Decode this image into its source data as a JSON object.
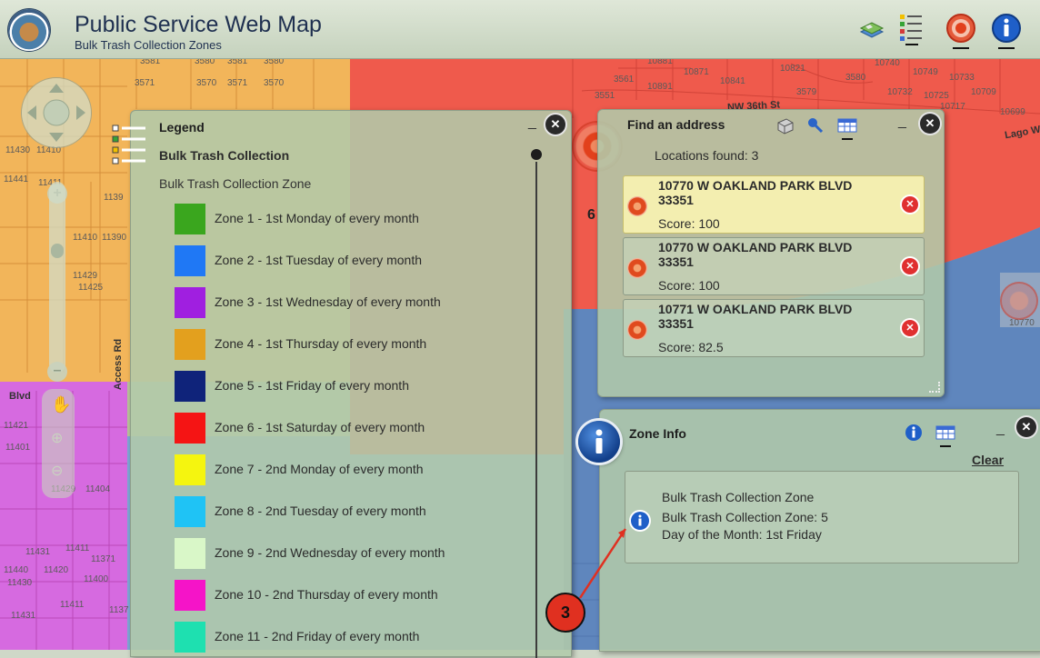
{
  "header": {
    "title": "Public Service Web Map",
    "subtitle": "Bulk Trash Collection Zones",
    "tools": [
      {
        "name": "basemap-icon"
      },
      {
        "name": "layer-list-icon"
      },
      {
        "name": "find-address-icon"
      },
      {
        "name": "info-icon"
      }
    ]
  },
  "map": {
    "street_labels": [
      "NW 36th St",
      "Access Rd",
      "Blvd",
      "Lago W"
    ],
    "parcel_labels": [
      "3581",
      "3580",
      "3581",
      "3580",
      "3571",
      "3570",
      "3571",
      "3570",
      "10881",
      "10871",
      "10841",
      "10821",
      "10740",
      "10749",
      "10733",
      "3561",
      "10891",
      "3579",
      "3580",
      "10732",
      "10725",
      "10709",
      "3551",
      "10717",
      "10699",
      "11430",
      "11410",
      "11441",
      "11411",
      "1139",
      "11410",
      "11390",
      "11429",
      "11425",
      "11421",
      "11401",
      "11431",
      "11411",
      "11371",
      "11429",
      "11404",
      "11440",
      "11420",
      "11400",
      "11430",
      "11411",
      "11431",
      "1137",
      "10770"
    ],
    "zone_labels": [
      "6"
    ]
  },
  "legend": {
    "title": "Legend",
    "layer_name": "Bulk Trash Collection",
    "field_name": "Bulk Trash Collection Zone",
    "minimize": "_",
    "close": "✕",
    "items": [
      {
        "label": "Zone 1 - 1st Monday of every month",
        "color": "#3aa61e"
      },
      {
        "label": "Zone 2 - 1st Tuesday of every month",
        "color": "#1f78f5"
      },
      {
        "label": "Zone 3 - 1st Wednesday of every month",
        "color": "#a01fe0"
      },
      {
        "label": "Zone 4 - 1st Thursday of every month",
        "color": "#e3a01e"
      },
      {
        "label": "Zone 5 - 1st Friday of every month",
        "color": "#0f237a"
      },
      {
        "label": "Zone 6 - 1st Saturday of every month",
        "color": "#f51414"
      },
      {
        "label": "Zone 7 - 2nd Monday of every month",
        "color": "#f5f50f"
      },
      {
        "label": "Zone 8 - 2nd Tuesday of every month",
        "color": "#1fc3f5"
      },
      {
        "label": "Zone 9 - 2nd Wednesday of every month",
        "color": "#d9f7c8"
      },
      {
        "label": "Zone 10 - 2nd Thursday of every month",
        "color": "#f514c8"
      },
      {
        "label": "Zone 11 - 2nd Friday of every month",
        "color": "#1ee0b0"
      }
    ]
  },
  "find_address": {
    "title": "Find an address",
    "minimize": "_",
    "close": "✕",
    "status": "Locations found: 3",
    "results": [
      {
        "address_line1": "10770 W OAKLAND PARK BLVD",
        "address_line2": "33351",
        "score": "Score: 100",
        "selected": true
      },
      {
        "address_line1": "10770 W OAKLAND PARK BLVD",
        "address_line2": "33351",
        "score": "Score: 100",
        "selected": false
      },
      {
        "address_line1": "10771 W OAKLAND PARK BLVD",
        "address_line2": "33351",
        "score": "Score: 82.5",
        "selected": false
      }
    ],
    "remove_glyph": "✕"
  },
  "zone_info": {
    "title": "Zone Info",
    "minimize": "_",
    "close": "✕",
    "clear_label": "Clear",
    "layer": "Bulk Trash Collection Zone",
    "field1": "Bulk Trash Collection Zone: 5",
    "field2": "Day of the Month: 1st Friday"
  },
  "callout": {
    "number": "3",
    "color": "#e03020"
  },
  "colors": {
    "zone_red": "#ef5a4c",
    "zone_blue": "#5f86bd",
    "zone_orange": "#f2b55a",
    "zone_magenta": "#d66ae0",
    "panel_green": "#b3caa9",
    "header_text": "#1f3050"
  }
}
